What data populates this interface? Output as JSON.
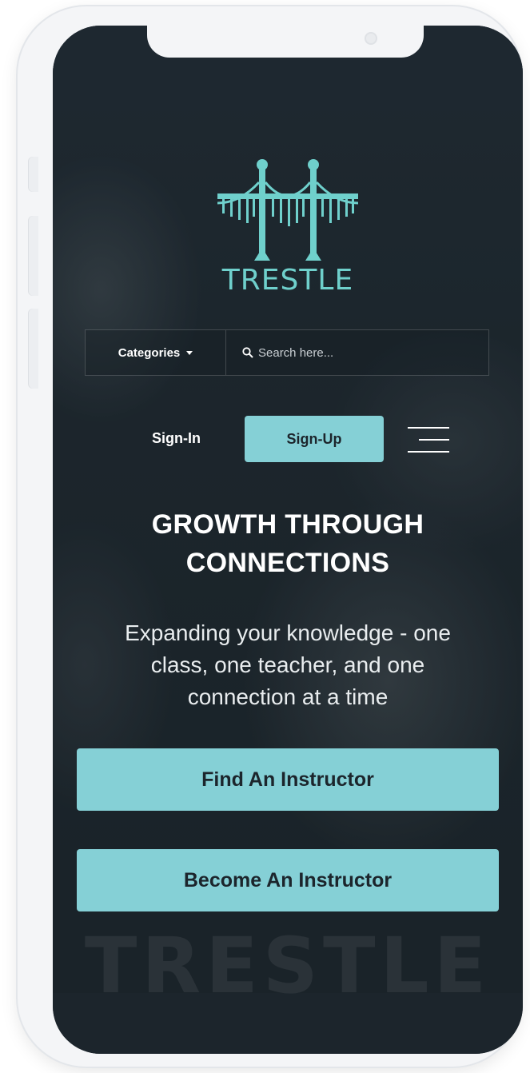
{
  "brand": {
    "name": "TRESTLE",
    "accent_color": "#85d0d6",
    "logo_color": "#6fd0cc",
    "background_color": "#1c252c"
  },
  "search": {
    "categories_label": "Categories",
    "placeholder": "Search here..."
  },
  "nav": {
    "signin_label": "Sign-In",
    "signup_label": "Sign-Up",
    "menu_icon": "hamburger-icon"
  },
  "hero": {
    "headline_line1": "GROWTH THROUGH",
    "headline_line2": "CONNECTIONS",
    "subtext_line1": "Expanding your knowledge - one",
    "subtext_line2": "class, one teacher, and one",
    "subtext_line3": "connection at a time"
  },
  "actions": {
    "find_label": "Find An Instructor",
    "become_label": "Become An Instructor"
  },
  "watermark": {
    "text": "TRESTLE"
  }
}
